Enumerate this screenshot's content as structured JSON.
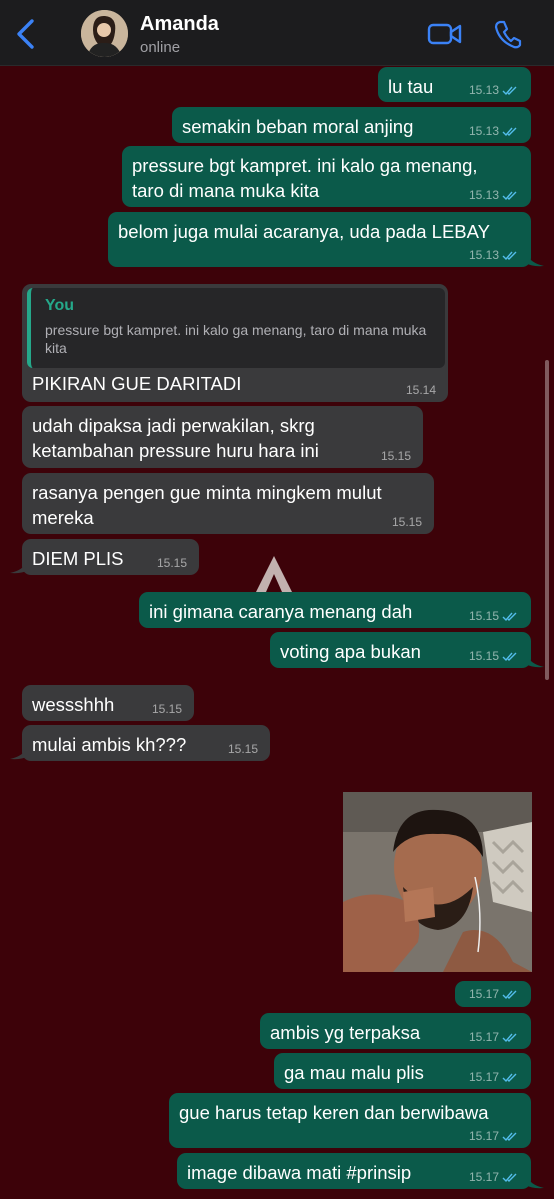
{
  "header": {
    "contact_name": "Amanda",
    "contact_status": "online",
    "icons": [
      "back-chevron-icon",
      "video-call-icon",
      "phone-icon"
    ],
    "accent_color": "#3b82f6"
  },
  "colors": {
    "background": "#3d0209",
    "outgoing_bubble": "#0b5a4a",
    "incoming_bubble": "#3a3a3c",
    "read_ticks": "#53bdeb",
    "quote_author": "#25a88a"
  },
  "messages": [
    {
      "dir": "out",
      "text": "lu tau",
      "time": "15.13"
    },
    {
      "dir": "out",
      "text": "semakin beban moral anjing",
      "time": "15.13"
    },
    {
      "dir": "out",
      "text": "pressure bgt kampret. ini kalo ga menang, taro di mana muka kita",
      "time": "15.13"
    },
    {
      "dir": "out",
      "text": "belom juga mulai acaranya, uda pada LEBAY",
      "time": "15.13"
    },
    {
      "dir": "in",
      "quote_author": "You",
      "quote_text": "pressure bgt kampret. ini kalo ga menang, taro di mana muka kita",
      "text": "PIKIRAN GUE DARITADI",
      "time": "15.14"
    },
    {
      "dir": "in",
      "text": "udah dipaksa jadi perwakilan, skrg ketambahan pressure huru hara ini",
      "time": "15.15"
    },
    {
      "dir": "in",
      "text": "rasanya pengen gue minta mingkem mulut mereka",
      "time": "15.15"
    },
    {
      "dir": "in",
      "text": "DIEM PLIS",
      "time": "15.15"
    },
    {
      "dir": "out",
      "text": "ini gimana caranya menang dah",
      "time": "15.15"
    },
    {
      "dir": "out",
      "text": "voting apa bukan",
      "time": "15.15"
    },
    {
      "dir": "in",
      "text": "wessshhh",
      "time": "15.15"
    },
    {
      "dir": "in",
      "text": "mulai ambis kh???",
      "time": "15.15"
    },
    {
      "dir": "out",
      "type": "photo",
      "time": "15.17"
    },
    {
      "dir": "out",
      "text": "ambis yg terpaksa",
      "time": "15.17"
    },
    {
      "dir": "out",
      "text": "ga mau malu plis",
      "time": "15.17"
    },
    {
      "dir": "out",
      "text": "gue harus tetap keren dan berwibawa",
      "time": "15.17"
    },
    {
      "dir": "out",
      "text": "image dibawa mati #prinsip",
      "time": "15.17"
    }
  ]
}
